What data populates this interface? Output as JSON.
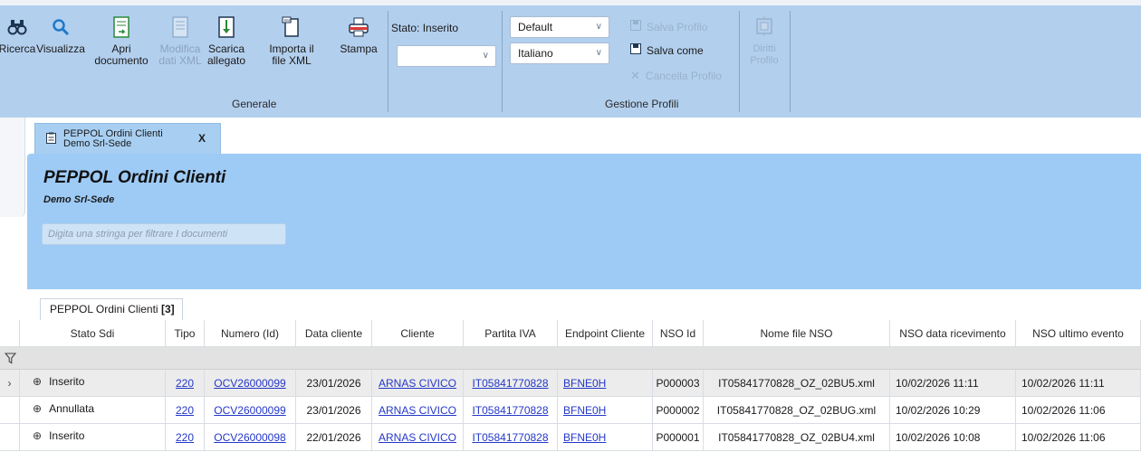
{
  "ribbon": {
    "buttons": [
      {
        "label1": "Ricerca",
        "label2": ""
      },
      {
        "label1": "Visualizza",
        "label2": ""
      },
      {
        "label1": "Apri",
        "label2": "documento"
      },
      {
        "label1": "Modifica",
        "label2": "dati XML"
      },
      {
        "label1": "Scarica",
        "label2": "allegato"
      },
      {
        "label1": "Importa il",
        "label2": "file XML"
      },
      {
        "label1": "Stampa",
        "label2": ""
      }
    ],
    "group_generale": "Generale",
    "stato_label": "Stato: Inserito",
    "stato_value": "",
    "profile_select_1": "Default",
    "profile_select_2": "Italiano",
    "salva_profilo": "Salva Profilo",
    "salva_come": "Salva come",
    "cancella_profilo": "Cancella Profilo",
    "diritti_label1": "Diritti",
    "diritti_label2": "Profilo",
    "group_profili": "Gestione Profili"
  },
  "doc_tab": {
    "line1": "PEPPOL Ordini Clienti",
    "line2": "Demo Srl-Sede",
    "close": "X"
  },
  "panel": {
    "title": "PEPPOL Ordini Clienti",
    "subtitle": "Demo Srl-Sede",
    "filter_placeholder": "Digita una stringa per filtrare I documenti"
  },
  "grid_tab": {
    "label": "PEPPOL Ordini Clienti",
    "count": "[3]"
  },
  "columns": [
    "Stato Sdi",
    "Tipo",
    "Numero (Id)",
    "Data cliente",
    "Cliente",
    "Partita IVA",
    "Endpoint Cliente",
    "NSO Id",
    "Nome file NSO",
    "NSO data ricevimento",
    "NSO ultimo evento"
  ],
  "rows": [
    {
      "stato": "Inserito",
      "tipo": "220",
      "numero": "OCV26000099",
      "data": "23/01/2026",
      "cliente": "ARNAS CIVICO",
      "piva": "IT05841770828",
      "endpoint": "BFNE0H",
      "nso_id": "P000003",
      "nome_file": "IT05841770828_OZ_02BU5.xml",
      "ricevimento": "10/02/2026 11:11",
      "ultimo": "10/02/2026 11:11"
    },
    {
      "stato": "Annullata",
      "tipo": "220",
      "numero": "OCV26000099",
      "data": "23/01/2026",
      "cliente": "ARNAS CIVICO",
      "piva": "IT05841770828",
      "endpoint": "BFNE0H",
      "nso_id": "P000002",
      "nome_file": "IT05841770828_OZ_02BUG.xml",
      "ricevimento": "10/02/2026 10:29",
      "ultimo": "10/02/2026 11:06"
    },
    {
      "stato": "Inserito",
      "tipo": "220",
      "numero": "OCV26000098",
      "data": "22/01/2026",
      "cliente": "ARNAS CIVICO",
      "piva": "IT05841770828",
      "endpoint": "BFNE0H",
      "nso_id": "P000001",
      "nome_file": "IT05841770828_OZ_02BU4.xml",
      "ricevimento": "10/02/2026 10:08",
      "ultimo": "10/02/2026 11:06"
    }
  ]
}
